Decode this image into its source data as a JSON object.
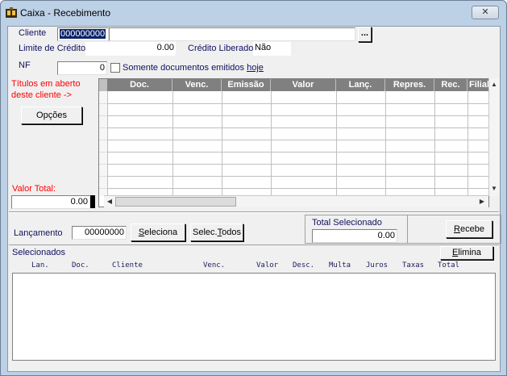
{
  "window": {
    "title": "Caixa - Recebimento",
    "close_label": "✕"
  },
  "header": {
    "cliente_label": "Cliente",
    "cliente_code": "000000000",
    "cliente_name": "",
    "browse_label": "...",
    "limite_label": "Limite de Crédito",
    "limite_value": "0.00",
    "credito_label": "Crédito Liberado",
    "credito_value": "Não",
    "nf_label": "NF",
    "nf_value": "0",
    "somente_label": "Somente documentos emitidos ",
    "somente_hotkey": "hoje"
  },
  "titulos": {
    "label_line1": "Títulos em aberto",
    "label_line2": "deste cliente ->",
    "opcoes_label": "Opções",
    "valor_total_label": "Valor Total:",
    "valor_total_value": "0.00",
    "columns": [
      "Doc.",
      "Venc.",
      "Emissão",
      "Valor",
      "Lanç.",
      "Repres.",
      "Rec.",
      "Filial"
    ],
    "rows": 10
  },
  "lancamento": {
    "label": "Lançamento",
    "value": "00000000",
    "seleciona_label": "Seleciona",
    "selec_todos_prefix": "Selec.",
    "selec_todos_hotkey": "T",
    "selec_todos_rest": "odos",
    "total_sel_label": "Total Selecionado",
    "total_sel_value": "0.00",
    "recebe_hotkey": "R",
    "recebe_rest": "ecebe"
  },
  "selecionados": {
    "label": "Selecionados",
    "elimina_hotkey": "E",
    "elimina_rest": "limina",
    "columns": [
      "Lan.",
      "Doc.",
      "Cliente",
      "Venc.",
      "Valor",
      "Desc.",
      "Multa",
      "Juros",
      "Taxas",
      "Total"
    ]
  }
}
